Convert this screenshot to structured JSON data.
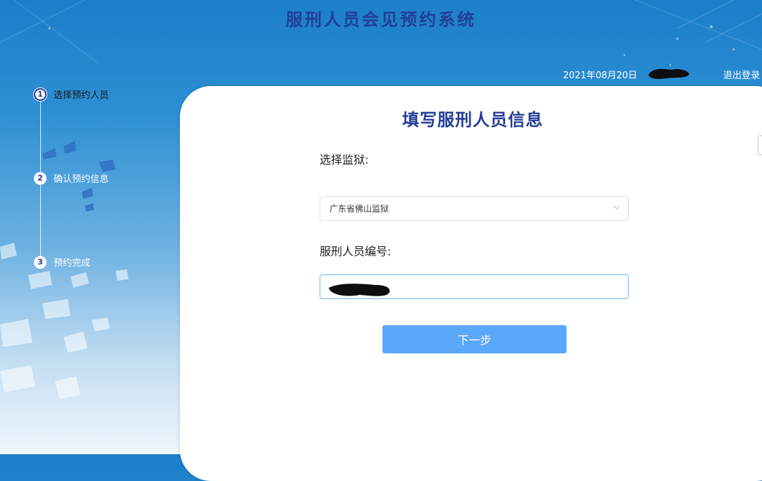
{
  "header": {
    "title": "服刑人员会见预约系统",
    "date": "2021年08月20日",
    "logout_label": "退出登录"
  },
  "steps": [
    {
      "number": "1",
      "label": "选择预约人员",
      "active": true
    },
    {
      "number": "2",
      "label": "确认预约信息",
      "active": false
    },
    {
      "number": "3",
      "label": "预约完成",
      "active": false
    }
  ],
  "form": {
    "title": "填写服刑人员信息",
    "prison_label": "选择监狱:",
    "prison_value": "广东省佛山监狱",
    "inmate_label": "服刑人员编号:",
    "next_label": "下一步"
  },
  "icons": {
    "select_chevron": "chevron-down-icon"
  },
  "colors": {
    "title_blue": "#233e96",
    "button_blue": "#5aa8f8",
    "input_focus_border": "#69b7f5"
  }
}
